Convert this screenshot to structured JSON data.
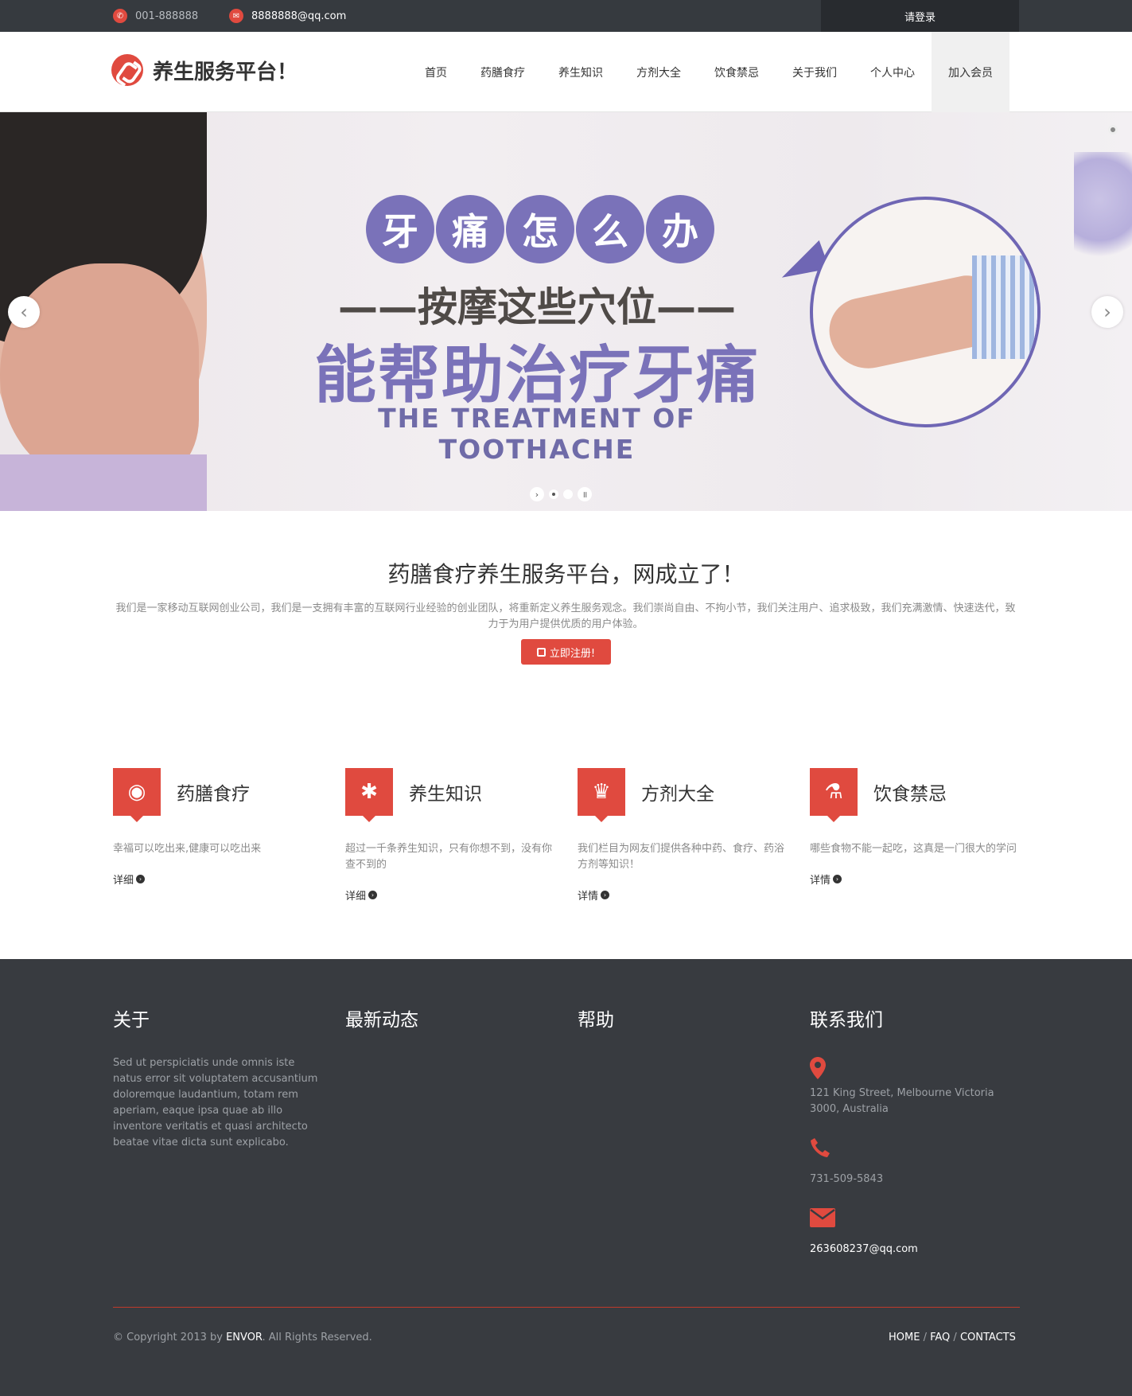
{
  "topbar": {
    "phone": "001-888888",
    "email": "8888888@qq.com",
    "login": "请登录"
  },
  "header": {
    "logo_text": "养生服务平台！",
    "nav": [
      "首页",
      "药膳食疗",
      "养生知识",
      "方剂大全",
      "饮食禁忌",
      "关于我们",
      "个人中心",
      "加入会员"
    ]
  },
  "slider": {
    "bubbles": [
      "牙",
      "痛",
      "怎",
      "么",
      "办"
    ],
    "line2": "——按摩这些穴位——",
    "line3": "能帮助治疗牙痛",
    "line4": "THE TREATMENT OF TOOTHACHE",
    "prev_icon": "chevron-left-icon",
    "next_icon": "chevron-right-icon"
  },
  "intro": {
    "title": "药膳食疗养生服务平台，网成立了！",
    "text": "我们是一家移动互联网创业公司，我们是一支拥有丰富的互联网行业经验的创业团队，将重新定义养生服务观念。我们崇尚自由、不拘小节，我们关注用户、追求极致，我们充满激情、快速迭代，致力于为用户提供优质的用户体验。",
    "register": "立即注册!"
  },
  "features": [
    {
      "icon": "globe-icon",
      "title": "药膳食疗",
      "text": "幸福可以吃出来,健康可以吃出来",
      "more": "详细"
    },
    {
      "icon": "gear-icon",
      "title": "养生知识",
      "text": "超过一千条养生知识，只有你想不到，没有你查不到的",
      "more": "详细"
    },
    {
      "icon": "trophy-icon",
      "title": "方剂大全",
      "text": "我们栏目为网友们提供各种中药、食疗、药浴方剂等知识！",
      "more": "详情"
    },
    {
      "icon": "flask-icon",
      "title": "饮食禁忌",
      "text": "哪些食物不能一起吃，这真是一门很大的学问",
      "more": "详情"
    }
  ],
  "footer": {
    "about_title": "关于",
    "about_text": "Sed ut perspiciatis unde omnis iste natus error sit voluptatem accusantium doloremque laudantium, totam rem aperiam, eaque ipsa quae ab illo inventore veritatis et quasi architecto beatae vitae dicta sunt explicabo.",
    "news_title": "最新动态",
    "help_title": "帮助",
    "contact_title": "联系我们",
    "address": "121 King Street, Melbourne Victoria 3000, Australia",
    "phone": "731-509-5843",
    "email": "263608237@qq.com",
    "copyright_pre": "© Copyright 2013 by",
    "copyright_brand": "ENVOR",
    "copyright_post": ". All Rights Reserved.",
    "links": [
      "HOME",
      "FAQ",
      "CONTACTS"
    ]
  },
  "colors": {
    "accent": "#e04a3f",
    "topbar": "#363a3f",
    "footer": "#383b40",
    "slide_purple": "#7a72b9"
  }
}
